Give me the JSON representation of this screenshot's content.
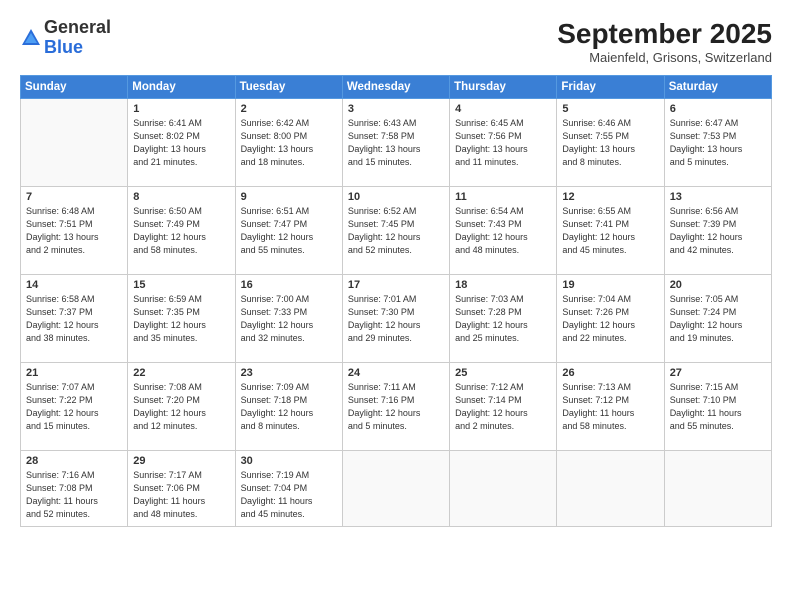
{
  "header": {
    "logo_line1": "General",
    "logo_line2": "Blue",
    "month_title": "September 2025",
    "location": "Maienfeld, Grisons, Switzerland"
  },
  "weekdays": [
    "Sunday",
    "Monday",
    "Tuesday",
    "Wednesday",
    "Thursday",
    "Friday",
    "Saturday"
  ],
  "weeks": [
    [
      {
        "day": "",
        "info": ""
      },
      {
        "day": "1",
        "info": "Sunrise: 6:41 AM\nSunset: 8:02 PM\nDaylight: 13 hours\nand 21 minutes."
      },
      {
        "day": "2",
        "info": "Sunrise: 6:42 AM\nSunset: 8:00 PM\nDaylight: 13 hours\nand 18 minutes."
      },
      {
        "day": "3",
        "info": "Sunrise: 6:43 AM\nSunset: 7:58 PM\nDaylight: 13 hours\nand 15 minutes."
      },
      {
        "day": "4",
        "info": "Sunrise: 6:45 AM\nSunset: 7:56 PM\nDaylight: 13 hours\nand 11 minutes."
      },
      {
        "day": "5",
        "info": "Sunrise: 6:46 AM\nSunset: 7:55 PM\nDaylight: 13 hours\nand 8 minutes."
      },
      {
        "day": "6",
        "info": "Sunrise: 6:47 AM\nSunset: 7:53 PM\nDaylight: 13 hours\nand 5 minutes."
      }
    ],
    [
      {
        "day": "7",
        "info": "Sunrise: 6:48 AM\nSunset: 7:51 PM\nDaylight: 13 hours\nand 2 minutes."
      },
      {
        "day": "8",
        "info": "Sunrise: 6:50 AM\nSunset: 7:49 PM\nDaylight: 12 hours\nand 58 minutes."
      },
      {
        "day": "9",
        "info": "Sunrise: 6:51 AM\nSunset: 7:47 PM\nDaylight: 12 hours\nand 55 minutes."
      },
      {
        "day": "10",
        "info": "Sunrise: 6:52 AM\nSunset: 7:45 PM\nDaylight: 12 hours\nand 52 minutes."
      },
      {
        "day": "11",
        "info": "Sunrise: 6:54 AM\nSunset: 7:43 PM\nDaylight: 12 hours\nand 48 minutes."
      },
      {
        "day": "12",
        "info": "Sunrise: 6:55 AM\nSunset: 7:41 PM\nDaylight: 12 hours\nand 45 minutes."
      },
      {
        "day": "13",
        "info": "Sunrise: 6:56 AM\nSunset: 7:39 PM\nDaylight: 12 hours\nand 42 minutes."
      }
    ],
    [
      {
        "day": "14",
        "info": "Sunrise: 6:58 AM\nSunset: 7:37 PM\nDaylight: 12 hours\nand 38 minutes."
      },
      {
        "day": "15",
        "info": "Sunrise: 6:59 AM\nSunset: 7:35 PM\nDaylight: 12 hours\nand 35 minutes."
      },
      {
        "day": "16",
        "info": "Sunrise: 7:00 AM\nSunset: 7:33 PM\nDaylight: 12 hours\nand 32 minutes."
      },
      {
        "day": "17",
        "info": "Sunrise: 7:01 AM\nSunset: 7:30 PM\nDaylight: 12 hours\nand 29 minutes."
      },
      {
        "day": "18",
        "info": "Sunrise: 7:03 AM\nSunset: 7:28 PM\nDaylight: 12 hours\nand 25 minutes."
      },
      {
        "day": "19",
        "info": "Sunrise: 7:04 AM\nSunset: 7:26 PM\nDaylight: 12 hours\nand 22 minutes."
      },
      {
        "day": "20",
        "info": "Sunrise: 7:05 AM\nSunset: 7:24 PM\nDaylight: 12 hours\nand 19 minutes."
      }
    ],
    [
      {
        "day": "21",
        "info": "Sunrise: 7:07 AM\nSunset: 7:22 PM\nDaylight: 12 hours\nand 15 minutes."
      },
      {
        "day": "22",
        "info": "Sunrise: 7:08 AM\nSunset: 7:20 PM\nDaylight: 12 hours\nand 12 minutes."
      },
      {
        "day": "23",
        "info": "Sunrise: 7:09 AM\nSunset: 7:18 PM\nDaylight: 12 hours\nand 8 minutes."
      },
      {
        "day": "24",
        "info": "Sunrise: 7:11 AM\nSunset: 7:16 PM\nDaylight: 12 hours\nand 5 minutes."
      },
      {
        "day": "25",
        "info": "Sunrise: 7:12 AM\nSunset: 7:14 PM\nDaylight: 12 hours\nand 2 minutes."
      },
      {
        "day": "26",
        "info": "Sunrise: 7:13 AM\nSunset: 7:12 PM\nDaylight: 11 hours\nand 58 minutes."
      },
      {
        "day": "27",
        "info": "Sunrise: 7:15 AM\nSunset: 7:10 PM\nDaylight: 11 hours\nand 55 minutes."
      }
    ],
    [
      {
        "day": "28",
        "info": "Sunrise: 7:16 AM\nSunset: 7:08 PM\nDaylight: 11 hours\nand 52 minutes."
      },
      {
        "day": "29",
        "info": "Sunrise: 7:17 AM\nSunset: 7:06 PM\nDaylight: 11 hours\nand 48 minutes."
      },
      {
        "day": "30",
        "info": "Sunrise: 7:19 AM\nSunset: 7:04 PM\nDaylight: 11 hours\nand 45 minutes."
      },
      {
        "day": "",
        "info": ""
      },
      {
        "day": "",
        "info": ""
      },
      {
        "day": "",
        "info": ""
      },
      {
        "day": "",
        "info": ""
      }
    ]
  ]
}
